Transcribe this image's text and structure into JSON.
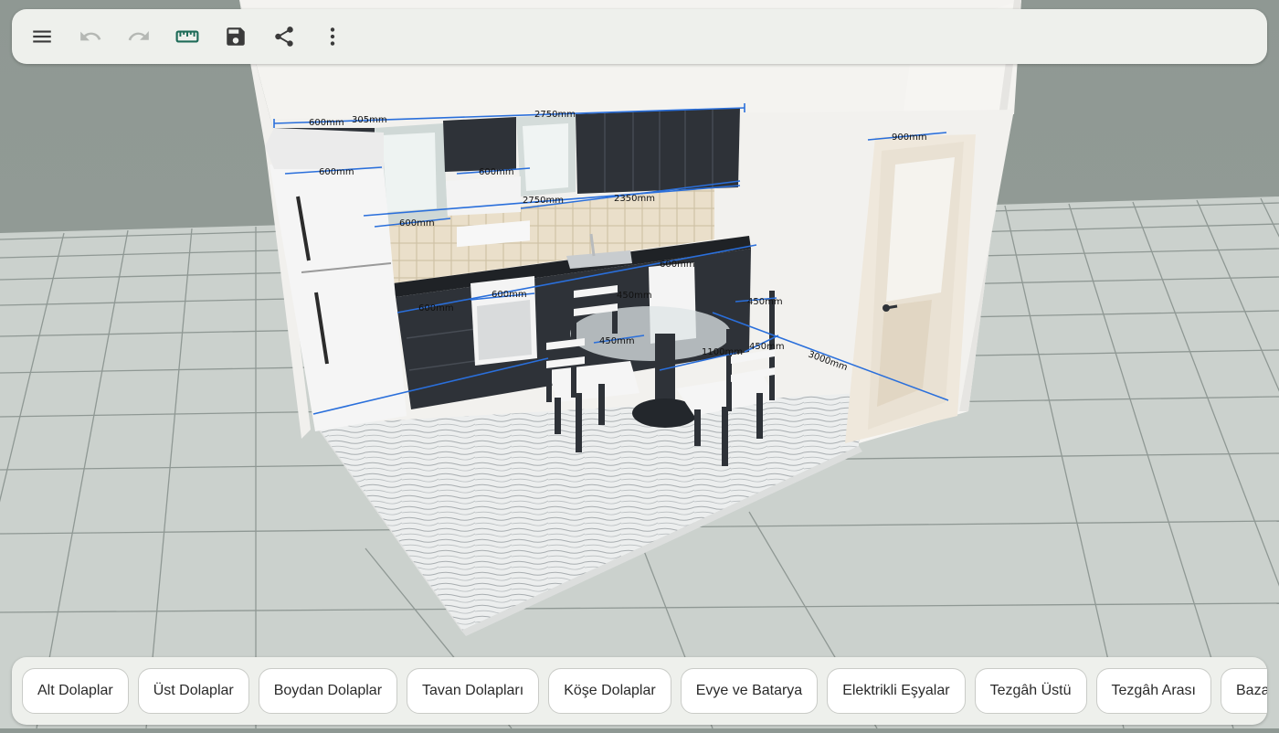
{
  "toolbar": {
    "icons": [
      "menu-icon",
      "undo-icon",
      "redo-icon",
      "ruler-icon",
      "save-icon",
      "share-icon",
      "more-vert-icon"
    ],
    "enabled_color": "#3a3a3a",
    "disabled_color": "#b5b8b4",
    "accent_color": "#1e6b58"
  },
  "scene": {
    "dimensions": {
      "top_total": "2750mm",
      "top_a": "600mm",
      "top_b": "305mm",
      "wall_2750": "2750mm",
      "wall_2350": "2350mm",
      "upper_600a": "600mm",
      "upper_600b": "600mm",
      "upper_600c": "600mm",
      "door_width": "900mm",
      "oven_600": "600mm",
      "counter_600": "600mm",
      "chair_450a": "450mm",
      "chair_450b": "450mm",
      "chair_450c": "450mm",
      "table_1100": "1100mm",
      "table_450": "450mm",
      "room_3000": "3000mm",
      "base_label": "600mm"
    },
    "colors": {
      "wall": "#f4f3f0",
      "cabinet": "#2e3238",
      "tile": "#eadfca",
      "floor_grid": "#c9cfcb",
      "dimension_line": "#2a6fdb"
    }
  },
  "categories": [
    "Alt Dolaplar",
    "Üst Dolaplar",
    "Boydan Dolaplar",
    "Tavan Dolapları",
    "Köşe Dolaplar",
    "Evye ve Batarya",
    "Elektrikli Eşyalar",
    "Tezgâh Üstü",
    "Tezgâh Arası",
    "Baza"
  ]
}
